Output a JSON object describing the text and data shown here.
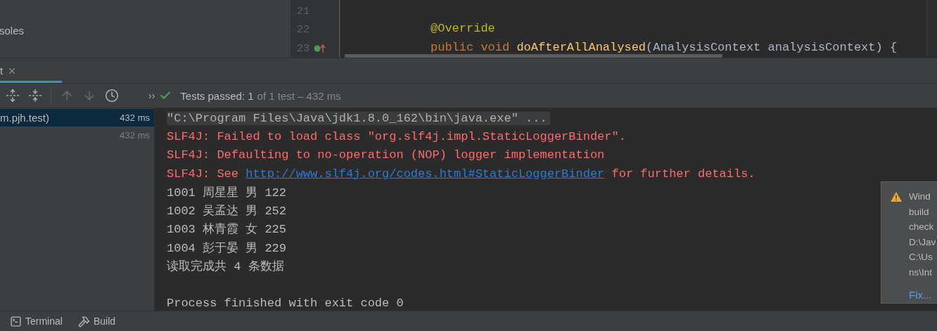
{
  "side_panel": {
    "label": "soles"
  },
  "editor": {
    "lines": [
      {
        "number": "21",
        "markers": false
      },
      {
        "number": "22",
        "markers": false,
        "tokens": [
          {
            "kind": "annotation",
            "text": "@Override"
          }
        ]
      },
      {
        "number": "23",
        "markers": true,
        "tokens": [
          {
            "kind": "keyword",
            "text": "public void "
          },
          {
            "kind": "method",
            "text": "doAfterAllAnalysed"
          },
          {
            "kind": "plain",
            "text": "(AnalysisContext analysisContext) {"
          }
        ]
      }
    ]
  },
  "run_tab": {
    "label": "t"
  },
  "toolbar": {
    "buttons": [
      {
        "kind": "expand",
        "disabled": false
      },
      {
        "kind": "collapse",
        "disabled": false
      },
      {
        "kind": "up",
        "disabled": true
      },
      {
        "kind": "down",
        "disabled": true
      },
      {
        "kind": "history",
        "disabled": false
      }
    ],
    "overflow": "››"
  },
  "test_status": {
    "passed": true,
    "label": "Tests passed:",
    "count": "1",
    "detail": "of 1 test – 432 ms"
  },
  "test_tree": [
    {
      "name": "m.pjh.test)",
      "time": "432 ms",
      "selected": true
    },
    {
      "time": "432 ms",
      "selected": false
    }
  ],
  "console": [
    {
      "kind": "command",
      "text": "\"C:\\Program Files\\Java\\jdk1.8.0_162\\bin\\java.exe\" ..."
    },
    {
      "kind": "error",
      "text": "SLF4J: Failed to load class \"org.slf4j.impl.StaticLoggerBinder\"."
    },
    {
      "kind": "error",
      "text": "SLF4J: Defaulting to no-operation (NOP) logger implementation"
    },
    {
      "kind": "link",
      "text": "SLF4J: See ",
      "link": "http://www.slf4j.org/codes.html#StaticLoggerBinder",
      "after": " for further details."
    },
    {
      "kind": "plain",
      "text": "1001 周星星 男 122"
    },
    {
      "kind": "plain",
      "text": "1002 吴孟达 男 252"
    },
    {
      "kind": "plain",
      "text": "1003 林青霞 女 225"
    },
    {
      "kind": "plain",
      "text": "1004 彭于晏 男 229"
    },
    {
      "kind": "plain",
      "text": "读取完成共 4 条数据"
    },
    {
      "kind": "blank"
    },
    {
      "kind": "plain",
      "text": "Process finished with exit code 0"
    }
  ],
  "notification": {
    "lines": [
      "Wind",
      "build",
      "check",
      "D:\\Jav",
      "C:\\Us",
      "ns\\Int"
    ],
    "action": "Fix..."
  },
  "tool_windows": [
    {
      "kind": "terminal",
      "label": "Terminal"
    },
    {
      "kind": "build",
      "label": "Build"
    }
  ]
}
